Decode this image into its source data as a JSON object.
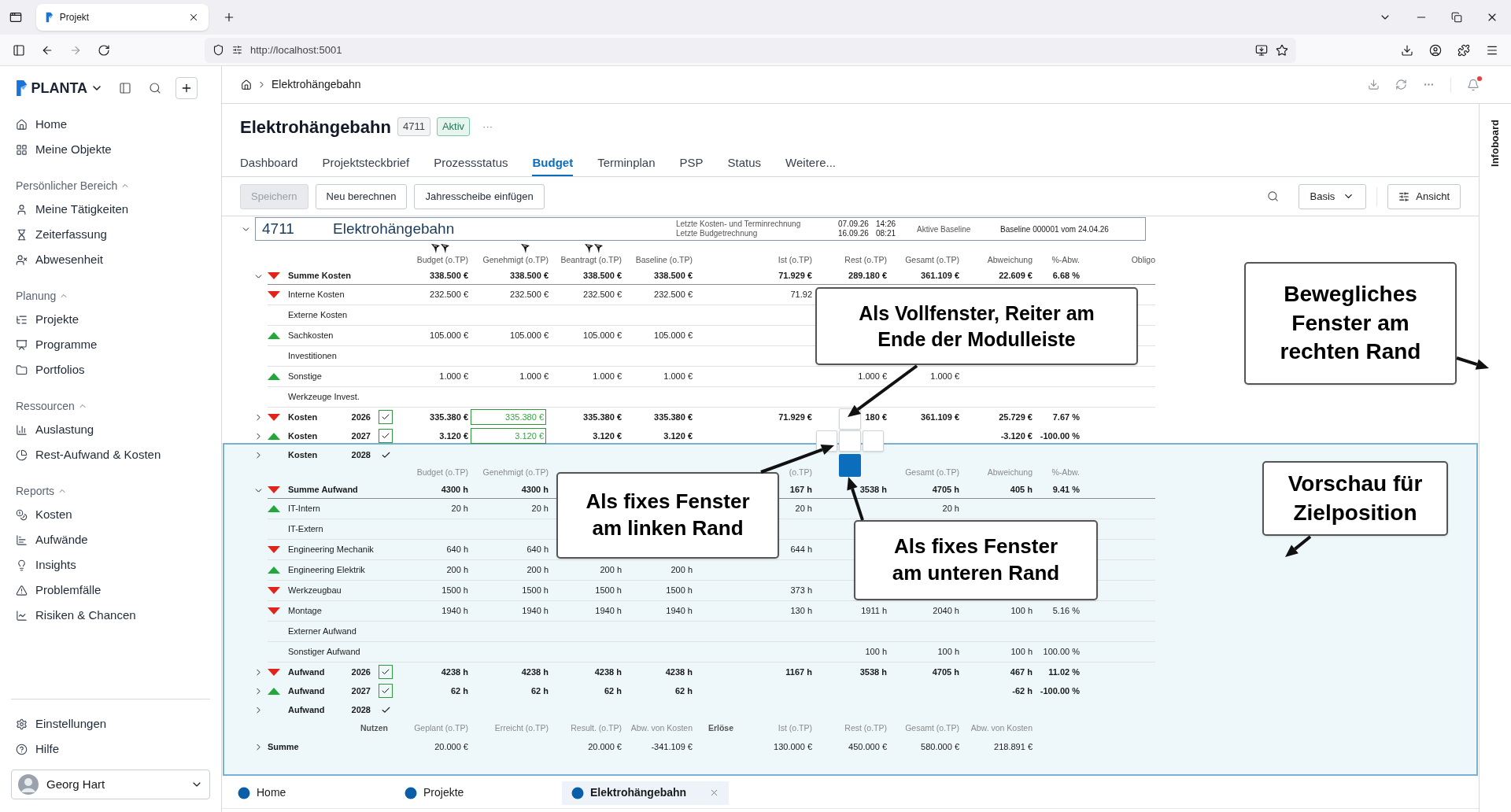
{
  "browser": {
    "tab_title": "Projekt",
    "url": "http://localhost:5001"
  },
  "sidebar": {
    "brand": "PLANTA",
    "items": [
      "Home",
      "Meine Objekte"
    ],
    "sections": [
      {
        "title": "Persönlicher Bereich",
        "expanded": true,
        "items": [
          "Meine Tätigkeiten",
          "Zeiterfassung",
          "Abwesenheit"
        ]
      },
      {
        "title": "Planung",
        "expanded": true,
        "items": [
          "Projekte",
          "Programme",
          "Portfolios"
        ]
      },
      {
        "title": "Ressourcen",
        "expanded": true,
        "items": [
          "Auslastung",
          "Rest-Aufwand & Kosten"
        ]
      },
      {
        "title": "Reports",
        "expanded": true,
        "items": [
          "Kosten",
          "Aufwände",
          "Insights",
          "Problemfälle",
          "Risiken & Chancen"
        ]
      }
    ],
    "footer_items": [
      "Einstellungen",
      "Hilfe"
    ],
    "user": "Georg Hart"
  },
  "header": {
    "breadcrumb": "Elektrohängebahn",
    "notification": true
  },
  "project": {
    "title": "Elektrohängebahn",
    "number": "4711",
    "status": "Aktiv",
    "more": "···"
  },
  "tabs": [
    {
      "label": "Dashboard",
      "selected": false
    },
    {
      "label": "Projektsteckbrief",
      "selected": false
    },
    {
      "label": "Prozessstatus",
      "selected": false
    },
    {
      "label": "Budget",
      "selected": true
    },
    {
      "label": "Terminplan",
      "selected": false
    },
    {
      "label": "PSP",
      "selected": false
    },
    {
      "label": "Status",
      "selected": false
    },
    {
      "label": "Weitere...",
      "selected": false
    }
  ],
  "toolbar": {
    "buttons": [
      {
        "label": "Speichern",
        "disabled": true
      },
      {
        "label": "Neu berechnen",
        "disabled": false
      },
      {
        "label": "Jahresscheibe einfügen",
        "disabled": false
      }
    ],
    "view_select": "Basis",
    "view_button": "Ansicht"
  },
  "infoboard": "Infoboard",
  "summary": {
    "number": "4711",
    "name": "Elektrohängebahn",
    "calculations": [
      {
        "label": "Letzte Kosten- und Terminrechnung",
        "date": "07.09.26",
        "time": "14:26"
      },
      {
        "label": "Letzte Budgetrechnung",
        "date": "16.09.26",
        "time": "08:21"
      }
    ],
    "baseline_label": "Aktive Baseline",
    "baseline": "Baseline 000001 vom 24.04.26"
  },
  "cost_table": {
    "columns": [
      {
        "label": "Budget (o.TP)",
        "marker": true,
        "double": true
      },
      {
        "label": "Genehmigt (o.TP)",
        "marker": true,
        "double": false
      },
      {
        "label": "Beantragt (o.TP)",
        "marker": true,
        "double": true
      },
      {
        "label": "Baseline (o.TP)"
      },
      {
        "label": "Ist (o.TP)"
      },
      {
        "label": "Rest (o.TP)"
      },
      {
        "label": "Gesamt (o.TP)"
      },
      {
        "label": "Abweichung"
      },
      {
        "label": "%-Abw."
      },
      {
        "label": "Obligo"
      }
    ],
    "rows": [
      {
        "kind": "sum",
        "label": "Summe Kosten",
        "rising": false,
        "expanded": true,
        "cells": [
          "338.500 €",
          "338.500 €",
          "338.500 €",
          "338.500 €",
          "71.929 €",
          "289.180 €",
          "361.109 €",
          "22.609 €",
          "6.68 %",
          null
        ]
      },
      {
        "kind": "item",
        "label": "Interne Kosten",
        "rising": false,
        "cells": [
          "232.500 €",
          "232.500 €",
          "232.500 €",
          "232.500 €",
          "71.92"
        ]
      },
      {
        "kind": "item",
        "label": "Externe Kosten"
      },
      {
        "kind": "item",
        "label": "Sachkosten",
        "rising": true,
        "cells": [
          "105.000 €",
          "105.000 €",
          "105.000 €",
          "105.000 €"
        ]
      },
      {
        "kind": "item",
        "label": "Investitionen"
      },
      {
        "kind": "item",
        "label": "Sonstige",
        "rising": true,
        "cells": [
          "1.000 €",
          "1.000 €",
          "1.000 €",
          "1.000 €",
          null,
          "1.000 €",
          "1.000 €"
        ]
      },
      {
        "kind": "item",
        "label": "Werkzeuge Invest."
      },
      {
        "kind": "year",
        "label": "Kosten",
        "year": "2026",
        "rising": false,
        "expanded": false,
        "checked": true,
        "highlighted": true,
        "approved_field": true,
        "cells": [
          "335.380 €",
          "335.380 €",
          "335.380 €",
          "335.380 €",
          "71.929 €",
          "180 €",
          "361.109 €",
          "25.729 €",
          "7.67 %"
        ]
      },
      {
        "kind": "year",
        "label": "Kosten",
        "year": "2027",
        "rising": true,
        "expanded": false,
        "checked": true,
        "highlighted": true,
        "approved_field": true,
        "cells": [
          "3.120 €",
          "3.120 €",
          "3.120 €",
          "3.120 €",
          null,
          null,
          null,
          "-3.120 €",
          "-100.00 %"
        ]
      },
      {
        "kind": "year",
        "label": "Kosten",
        "year": "2028",
        "expanded": false,
        "checked": true,
        "highlighted": false
      }
    ]
  },
  "effort_table": {
    "columns": [
      "Budget (o.TP)",
      "Genehmigt (o.TP)",
      null,
      null,
      "(o.TP)",
      null,
      "Gesamt (o.TP)",
      "Abweichung",
      "%-Abw.",
      null
    ],
    "rows": [
      {
        "kind": "sum",
        "label": "Summe Aufwand",
        "rising": false,
        "expanded": true,
        "cells": [
          "4300 h",
          "4300 h",
          null,
          null,
          "167 h",
          "3538 h",
          "4705 h",
          "405 h",
          "9.41 %"
        ]
      },
      {
        "kind": "item",
        "label": "IT-Intern",
        "rising": true,
        "cells": [
          "20 h",
          "20 h",
          null,
          null,
          "20 h",
          null,
          "20 h"
        ]
      },
      {
        "kind": "item",
        "label": "IT-Extern"
      },
      {
        "kind": "item",
        "label": "Engineering Mechanik",
        "rising": false,
        "cells": [
          "640 h",
          "640 h",
          null,
          null,
          "644 h"
        ]
      },
      {
        "kind": "item",
        "label": "Engineering Elektrik",
        "rising": true,
        "cells": [
          "200 h",
          "200 h",
          "200 h",
          "200 h"
        ]
      },
      {
        "kind": "item",
        "label": "Werkzeugbau",
        "rising": false,
        "cells": [
          "1500 h",
          "1500 h",
          "1500 h",
          "1500 h",
          "373 h"
        ]
      },
      {
        "kind": "item",
        "label": "Montage",
        "rising": false,
        "cells": [
          "1940 h",
          "1940 h",
          "1940 h",
          "1940 h",
          "130 h",
          "1911 h",
          "2040 h",
          "100 h",
          "5.16 %"
        ]
      },
      {
        "kind": "item",
        "label": "Externer Aufwand"
      },
      {
        "kind": "item",
        "label": "Sonstiger Aufwand",
        "cells": [
          null,
          null,
          null,
          null,
          null,
          "100 h",
          "100 h",
          "100 h",
          "100.00 %"
        ]
      },
      {
        "kind": "year",
        "label": "Aufwand",
        "year": "2026",
        "rising": false,
        "expanded": false,
        "checked": true,
        "highlighted": true,
        "cells": [
          "4238 h",
          "4238 h",
          "4238 h",
          "4238 h",
          "1167 h",
          "3538 h",
          "4705 h",
          "467 h",
          "11.02 %"
        ]
      },
      {
        "kind": "year",
        "label": "Aufwand",
        "year": "2027",
        "rising": true,
        "expanded": false,
        "checked": true,
        "highlighted": true,
        "cells": [
          "62 h",
          "62 h",
          "62 h",
          "62 h",
          null,
          null,
          null,
          "-62 h",
          "-100.00 %"
        ]
      },
      {
        "kind": "year",
        "label": "Aufwand",
        "year": "2028",
        "expanded": false,
        "checked": true,
        "highlighted": false
      }
    ]
  },
  "benefit_table": {
    "title": "Nutzen",
    "revenue_title": "Erlöse",
    "columns": [
      "Geplant (o.TP)",
      "Erreicht (o.TP)",
      "Result. (o.TP)",
      "Abw. von Kosten",
      "Ist (o.TP)",
      "Rest (o.TP)",
      "Gesamt (o.TP)",
      "Abw. von Kosten"
    ],
    "rows": [
      {
        "label": "Summe",
        "expanded": false,
        "cells": [
          "20.000 €",
          null,
          "20.000 €",
          "-341.109 €",
          "130.000 €",
          "450.000 €",
          "580.000 €",
          "218.891 €"
        ]
      }
    ]
  },
  "module_tabs": [
    {
      "label": "Home",
      "selected": false
    },
    {
      "label": "Projekte",
      "selected": false
    },
    {
      "label": "Elektrohängebahn",
      "selected": true
    }
  ],
  "callouts": [
    {
      "lines": [
        "Als Vollfenster, Reiter am",
        "Ende der Modulleiste"
      ]
    },
    {
      "lines": [
        "Bewegliches",
        "Fenster am",
        "rechten Rand"
      ]
    },
    {
      "lines": [
        "Als fixes Fenster",
        "am linken Rand"
      ]
    },
    {
      "lines": [
        "Vorschau für",
        "Zielposition"
      ]
    },
    {
      "lines": [
        "Als fixes Fenster",
        "am unteren Rand"
      ]
    }
  ]
}
